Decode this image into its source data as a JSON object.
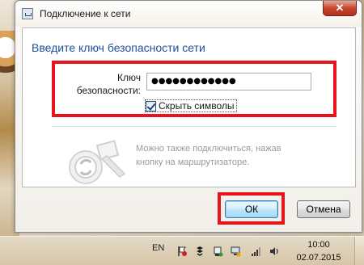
{
  "window": {
    "title": "Подключение к сети",
    "close_label": "✕"
  },
  "dialog": {
    "heading": "Введите ключ безопасности сети",
    "key_label_line1": "Ключ",
    "key_label_line2": "безопасности:",
    "key_value": "●●●●●●●●●●●●",
    "hide_chars_label": "Скрыть символы",
    "hide_chars_checked": true,
    "hint_line1": "Можно также подключиться, нажав",
    "hint_line2": "кнопку на маршрутизаторе.",
    "ok_label": "ОК",
    "cancel_label": "Отмена"
  },
  "taskbar": {
    "language": "EN",
    "time": "10:00",
    "date": "02.07.2015",
    "tray_icons": [
      "flag-icon",
      "dropbox-icon",
      "usb-icon",
      "network-icon",
      "signal-icon",
      "volume-icon"
    ]
  },
  "colors": {
    "heading": "#1e4f9c",
    "highlight_red": "#e8141d",
    "close_red": "#c6452f"
  }
}
